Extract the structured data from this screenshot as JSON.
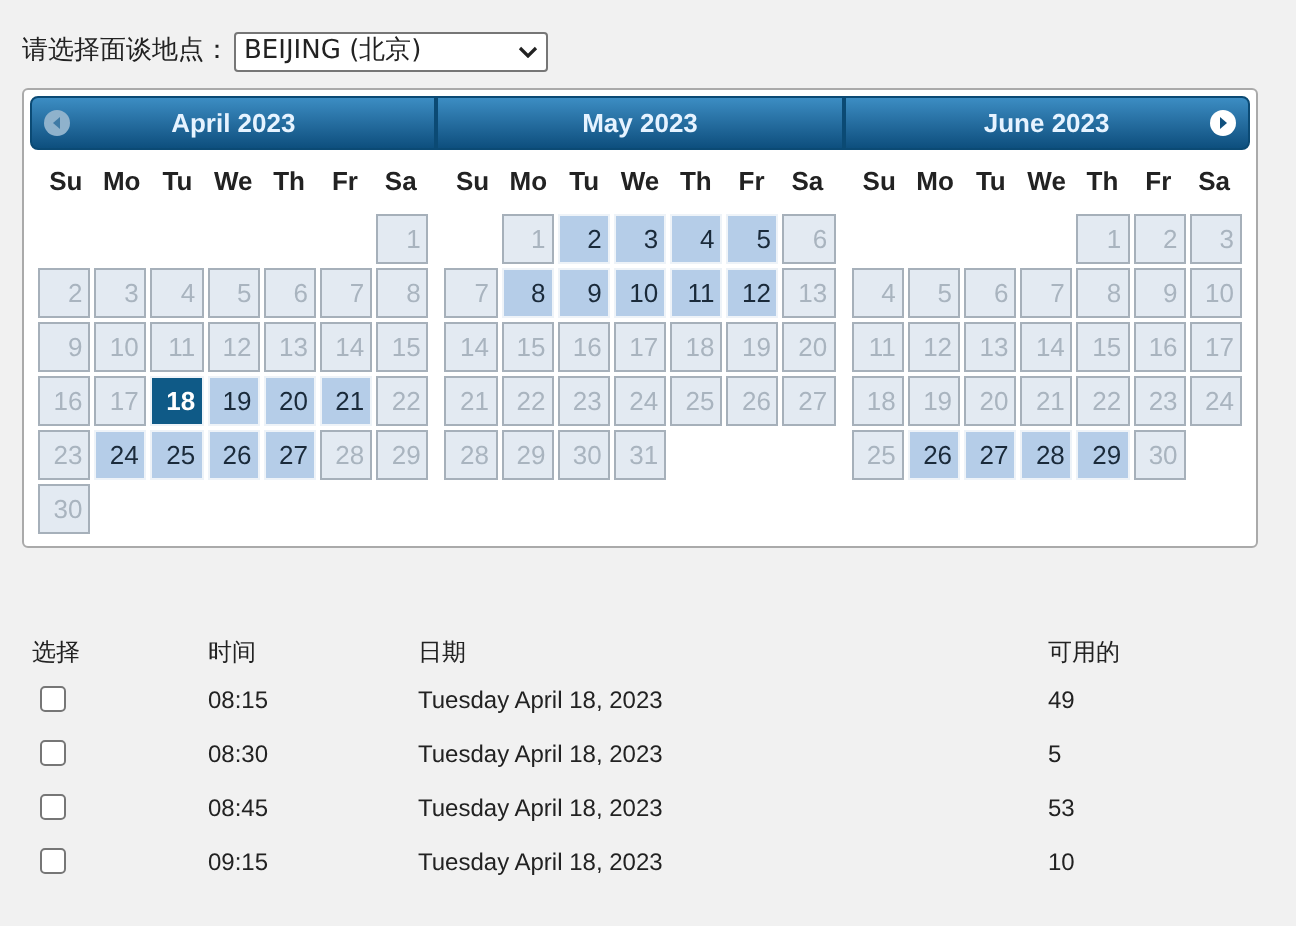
{
  "location": {
    "label": "请选择面谈地点：",
    "value": "BEIJING (北京)"
  },
  "calendar": {
    "months": [
      {
        "title": "April 2023",
        "weekdays": [
          "Su",
          "Mo",
          "Tu",
          "We",
          "Th",
          "Fr",
          "Sa"
        ],
        "weeks": [
          [
            {
              "kind": "blank"
            },
            {
              "kind": "blank"
            },
            {
              "kind": "blank"
            },
            {
              "kind": "blank"
            },
            {
              "kind": "blank"
            },
            {
              "kind": "blank"
            },
            {
              "day": "1",
              "kind": "off",
              "selected": false
            }
          ],
          [
            {
              "day": "2",
              "kind": "off",
              "selected": false
            },
            {
              "day": "3",
              "kind": "off",
              "selected": false
            },
            {
              "day": "4",
              "kind": "off",
              "selected": false
            },
            {
              "day": "5",
              "kind": "off",
              "selected": false
            },
            {
              "day": "6",
              "kind": "off",
              "selected": false
            },
            {
              "day": "7",
              "kind": "off",
              "selected": false
            },
            {
              "day": "8",
              "kind": "off",
              "selected": false
            }
          ],
          [
            {
              "day": "9",
              "kind": "off",
              "selected": false
            },
            {
              "day": "10",
              "kind": "off",
              "selected": false
            },
            {
              "day": "11",
              "kind": "off",
              "selected": false
            },
            {
              "day": "12",
              "kind": "off",
              "selected": false
            },
            {
              "day": "13",
              "kind": "off",
              "selected": false
            },
            {
              "day": "14",
              "kind": "off",
              "selected": false
            },
            {
              "day": "15",
              "kind": "off",
              "selected": false
            }
          ],
          [
            {
              "day": "16",
              "kind": "off",
              "selected": false
            },
            {
              "day": "17",
              "kind": "off",
              "selected": false
            },
            {
              "day": "18",
              "kind": "open",
              "selected": true
            },
            {
              "day": "19",
              "kind": "open",
              "selected": false
            },
            {
              "day": "20",
              "kind": "open",
              "selected": false
            },
            {
              "day": "21",
              "kind": "open",
              "selected": false
            },
            {
              "day": "22",
              "kind": "off",
              "selected": false
            }
          ],
          [
            {
              "day": "23",
              "kind": "off",
              "selected": false
            },
            {
              "day": "24",
              "kind": "open",
              "selected": false
            },
            {
              "day": "25",
              "kind": "open",
              "selected": false
            },
            {
              "day": "26",
              "kind": "open",
              "selected": false
            },
            {
              "day": "27",
              "kind": "open",
              "selected": false
            },
            {
              "day": "28",
              "kind": "off",
              "selected": false
            },
            {
              "day": "29",
              "kind": "off",
              "selected": false
            }
          ],
          [
            {
              "day": "30",
              "kind": "off",
              "selected": false
            }
          ]
        ]
      },
      {
        "title": "May 2023",
        "weekdays": [
          "Su",
          "Mo",
          "Tu",
          "We",
          "Th",
          "Fr",
          "Sa"
        ],
        "weeks": [
          [
            {
              "kind": "blank"
            },
            {
              "day": "1",
              "kind": "off",
              "selected": false
            },
            {
              "day": "2",
              "kind": "open",
              "selected": false
            },
            {
              "day": "3",
              "kind": "open",
              "selected": false
            },
            {
              "day": "4",
              "kind": "open",
              "selected": false
            },
            {
              "day": "5",
              "kind": "open",
              "selected": false
            },
            {
              "day": "6",
              "kind": "off",
              "selected": false
            }
          ],
          [
            {
              "day": "7",
              "kind": "off",
              "selected": false
            },
            {
              "day": "8",
              "kind": "open",
              "selected": false
            },
            {
              "day": "9",
              "kind": "open",
              "selected": false
            },
            {
              "day": "10",
              "kind": "open",
              "selected": false
            },
            {
              "day": "11",
              "kind": "open",
              "selected": false
            },
            {
              "day": "12",
              "kind": "open",
              "selected": false
            },
            {
              "day": "13",
              "kind": "off",
              "selected": false
            }
          ],
          [
            {
              "day": "14",
              "kind": "off",
              "selected": false
            },
            {
              "day": "15",
              "kind": "off",
              "selected": false
            },
            {
              "day": "16",
              "kind": "off",
              "selected": false
            },
            {
              "day": "17",
              "kind": "off",
              "selected": false
            },
            {
              "day": "18",
              "kind": "off",
              "selected": false
            },
            {
              "day": "19",
              "kind": "off",
              "selected": false
            },
            {
              "day": "20",
              "kind": "off",
              "selected": false
            }
          ],
          [
            {
              "day": "21",
              "kind": "off",
              "selected": false
            },
            {
              "day": "22",
              "kind": "off",
              "selected": false
            },
            {
              "day": "23",
              "kind": "off",
              "selected": false
            },
            {
              "day": "24",
              "kind": "off",
              "selected": false
            },
            {
              "day": "25",
              "kind": "off",
              "selected": false
            },
            {
              "day": "26",
              "kind": "off",
              "selected": false
            },
            {
              "day": "27",
              "kind": "off",
              "selected": false
            }
          ],
          [
            {
              "day": "28",
              "kind": "off",
              "selected": false
            },
            {
              "day": "29",
              "kind": "off",
              "selected": false
            },
            {
              "day": "30",
              "kind": "off",
              "selected": false
            },
            {
              "day": "31",
              "kind": "off",
              "selected": false
            }
          ]
        ]
      },
      {
        "title": "June 2023",
        "weekdays": [
          "Su",
          "Mo",
          "Tu",
          "We",
          "Th",
          "Fr",
          "Sa"
        ],
        "weeks": [
          [
            {
              "kind": "blank"
            },
            {
              "kind": "blank"
            },
            {
              "kind": "blank"
            },
            {
              "kind": "blank"
            },
            {
              "day": "1",
              "kind": "off",
              "selected": false
            },
            {
              "day": "2",
              "kind": "off",
              "selected": false
            },
            {
              "day": "3",
              "kind": "off",
              "selected": false
            }
          ],
          [
            {
              "day": "4",
              "kind": "off",
              "selected": false
            },
            {
              "day": "5",
              "kind": "off",
              "selected": false
            },
            {
              "day": "6",
              "kind": "off",
              "selected": false
            },
            {
              "day": "7",
              "kind": "off",
              "selected": false
            },
            {
              "day": "8",
              "kind": "off",
              "selected": false
            },
            {
              "day": "9",
              "kind": "off",
              "selected": false
            },
            {
              "day": "10",
              "kind": "off",
              "selected": false
            }
          ],
          [
            {
              "day": "11",
              "kind": "off",
              "selected": false
            },
            {
              "day": "12",
              "kind": "off",
              "selected": false
            },
            {
              "day": "13",
              "kind": "off",
              "selected": false
            },
            {
              "day": "14",
              "kind": "off",
              "selected": false
            },
            {
              "day": "15",
              "kind": "off",
              "selected": false
            },
            {
              "day": "16",
              "kind": "off",
              "selected": false
            },
            {
              "day": "17",
              "kind": "off",
              "selected": false
            }
          ],
          [
            {
              "day": "18",
              "kind": "off",
              "selected": false
            },
            {
              "day": "19",
              "kind": "off",
              "selected": false
            },
            {
              "day": "20",
              "kind": "off",
              "selected": false
            },
            {
              "day": "21",
              "kind": "off",
              "selected": false
            },
            {
              "day": "22",
              "kind": "off",
              "selected": false
            },
            {
              "day": "23",
              "kind": "off",
              "selected": false
            },
            {
              "day": "24",
              "kind": "off",
              "selected": false
            }
          ],
          [
            {
              "day": "25",
              "kind": "off",
              "selected": false
            },
            {
              "day": "26",
              "kind": "open",
              "selected": false
            },
            {
              "day": "27",
              "kind": "open",
              "selected": false
            },
            {
              "day": "28",
              "kind": "open",
              "selected": false
            },
            {
              "day": "29",
              "kind": "open",
              "selected": false
            },
            {
              "day": "30",
              "kind": "off",
              "selected": false
            }
          ]
        ]
      }
    ]
  },
  "table": {
    "columns": [
      "选择",
      "时间",
      "日期",
      "可用的"
    ],
    "rows": [
      {
        "checked": false,
        "time": "08:15",
        "date": "Tuesday April 18, 2023",
        "available": "49"
      },
      {
        "checked": false,
        "time": "08:30",
        "date": "Tuesday April 18, 2023",
        "available": "5"
      },
      {
        "checked": false,
        "time": "08:45",
        "date": "Tuesday April 18, 2023",
        "available": "53"
      },
      {
        "checked": false,
        "time": "09:15",
        "date": "Tuesday April 18, 2023",
        "available": "10"
      }
    ]
  }
}
